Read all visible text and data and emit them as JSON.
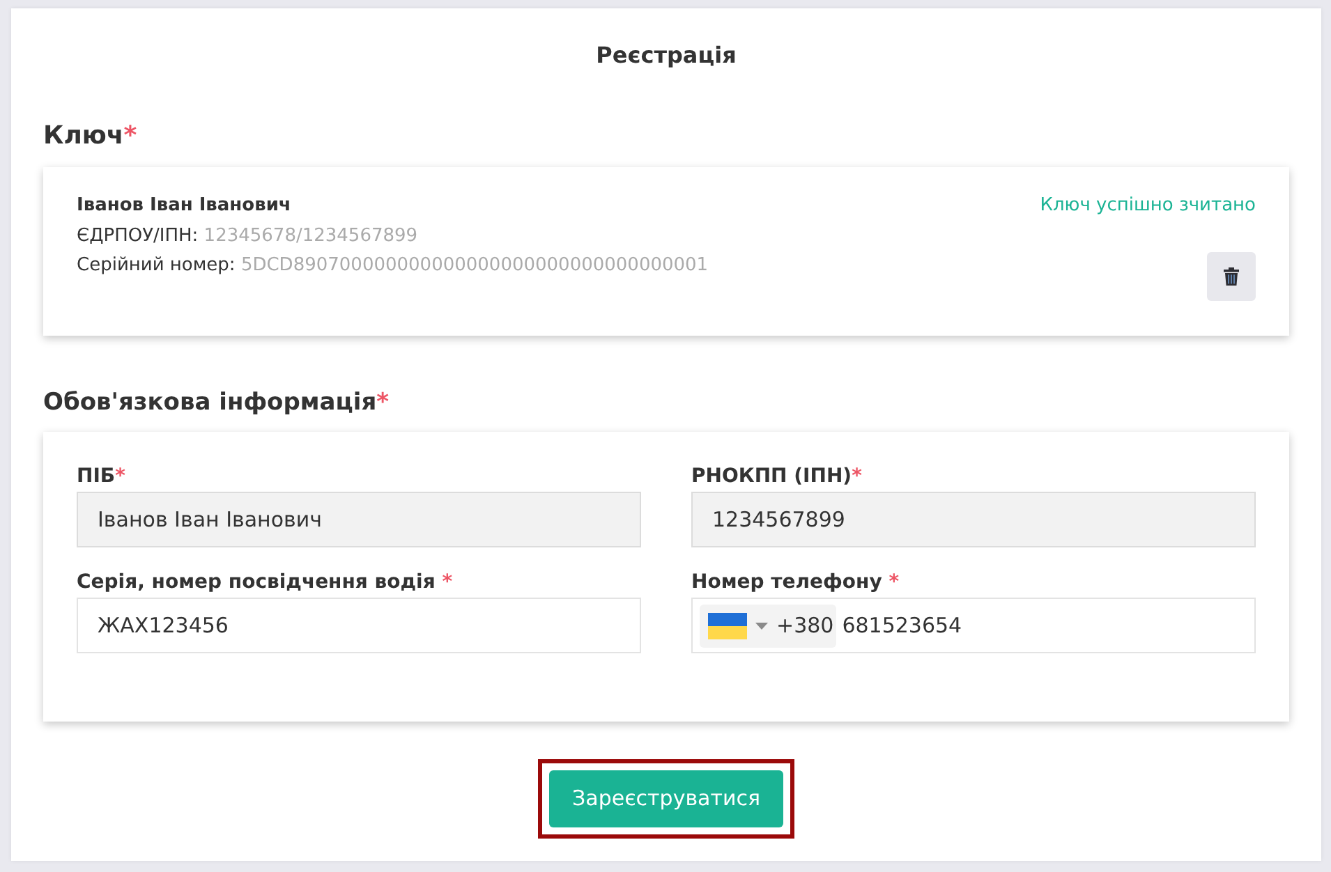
{
  "page": {
    "title": "Реєстрація"
  },
  "key_section": {
    "heading": "Ключ",
    "required_mark": "*",
    "owner": "Іванов Іван Іванович",
    "details": [
      {
        "label": "ЄДРПОУ/ІПН:",
        "value": "12345678/1234567899"
      },
      {
        "label": "Серійний номер:",
        "value": "5DCD890700000000000000000000000000000001"
      }
    ],
    "status": "Ключ успішно зчитано"
  },
  "required_section": {
    "heading": "Обов'язкова інформація",
    "required_mark": "*",
    "fields": [
      {
        "kind": "text",
        "label": "ПІБ",
        "required_mark": "*",
        "value": "Іванов Іван Іванович",
        "readonly": true
      },
      {
        "kind": "text",
        "label": "РНОКПП (ІПН)",
        "required_mark": "*",
        "value": "1234567899",
        "readonly": true
      },
      {
        "kind": "text",
        "label": "Серія, номер посвідчення водія ",
        "required_mark": "*",
        "value": "ЖАХ123456",
        "readonly": false
      },
      {
        "kind": "phone",
        "label": "Номер телефону ",
        "required_mark": "*",
        "country_code": "+380",
        "value": "681523654",
        "readonly": false
      }
    ]
  },
  "submit_button": {
    "label": "Зареєструватися",
    "highlighted": true
  }
}
